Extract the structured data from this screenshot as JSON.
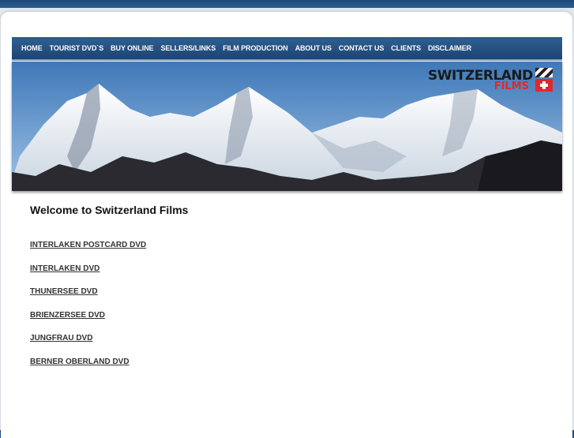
{
  "nav": {
    "items": [
      "HOME",
      "TOURIST DVD`S",
      "BUY ONLINE",
      "SELLERS/LINKS",
      "FILM PRODUCTION",
      "ABOUT US",
      "CONTACT US",
      "CLIENTS",
      "DISCLAIMER"
    ]
  },
  "banner": {
    "logo_top": "SWITZERLAND",
    "logo_bottom": "FILMS"
  },
  "main": {
    "heading": "Welcome to Switzerland Films",
    "links": [
      "INTERLAKEN POSTCARD DVD",
      "INTERLAKEN DVD",
      "THUNERSEE DVD",
      "BRIENZERSEE DVD",
      "JUNGFRAU DVD",
      "BERNER OBERLAND DVD"
    ]
  },
  "colors": {
    "nav": "#2a5688",
    "accent_red": "#e0282b",
    "sky": "#5a8ec8"
  }
}
